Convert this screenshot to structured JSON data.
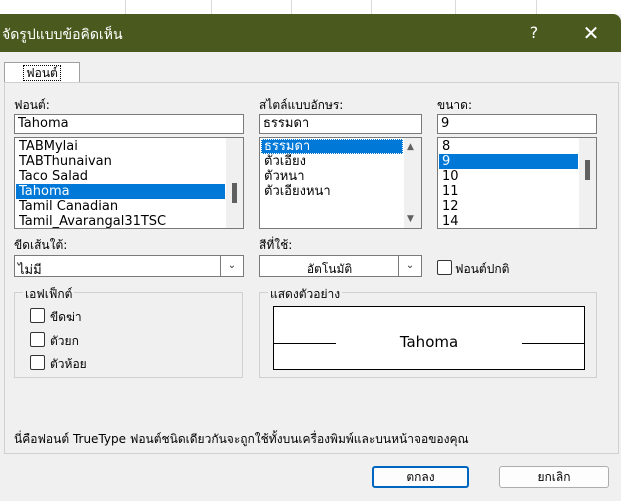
{
  "window": {
    "title": "จัดรูปแบบข้อคิดเห็น",
    "help_glyph": "?",
    "close_glyph": "✕"
  },
  "tabs": [
    {
      "label": "ฟอนต์"
    }
  ],
  "font": {
    "label": "ฟอนต์:",
    "value": "Tahoma",
    "items": [
      "TABMylai",
      "TABThunaivan",
      "Taco Salad",
      "Tahoma",
      "Tamil Canadian",
      "Tamil_Avarangal31TSC"
    ],
    "selected_index": 3
  },
  "style": {
    "label": "สไตล์แบบอักษร:",
    "value": "ธรรมดา",
    "items": [
      "ธรรมดา",
      "ตัวเอียง",
      "ตัวหนา",
      "ตัวเอียงหนา"
    ],
    "selected_index": 0
  },
  "size": {
    "label": "ขนาด:",
    "value": "9",
    "items": [
      "8",
      "9",
      "10",
      "11",
      "12",
      "14"
    ],
    "selected_index": 1
  },
  "underline": {
    "label": "ขีดเส้นใต้:",
    "value": "ไม่มี"
  },
  "color": {
    "label": "สีที่ใช้:",
    "value": "อัตโนมัติ"
  },
  "normal_font": {
    "label": "ฟอนต์ปกติ",
    "checked": false
  },
  "effects": {
    "legend": "เอฟเฟ็กต์",
    "items": [
      {
        "label": "ขีดฆ่า",
        "checked": false
      },
      {
        "label": "ตัวยก",
        "checked": false
      },
      {
        "label": "ตัวห้อย",
        "checked": false
      }
    ]
  },
  "preview": {
    "legend": "แสดงตัวอย่าง",
    "text": "Tahoma"
  },
  "note": "นี่คือฟอนต์ TrueType  ฟอนต์ชนิดเดียวกันจะถูกใช้ทั้งบนเครื่องพิมพ์และบนหน้าจอของคุณ",
  "buttons": {
    "ok": "ตกลง",
    "cancel": "ยกเลิก"
  },
  "colors": {
    "titlebar": "#4a5a1e",
    "selection": "#0078d7",
    "ok_border": "#0067c0"
  }
}
